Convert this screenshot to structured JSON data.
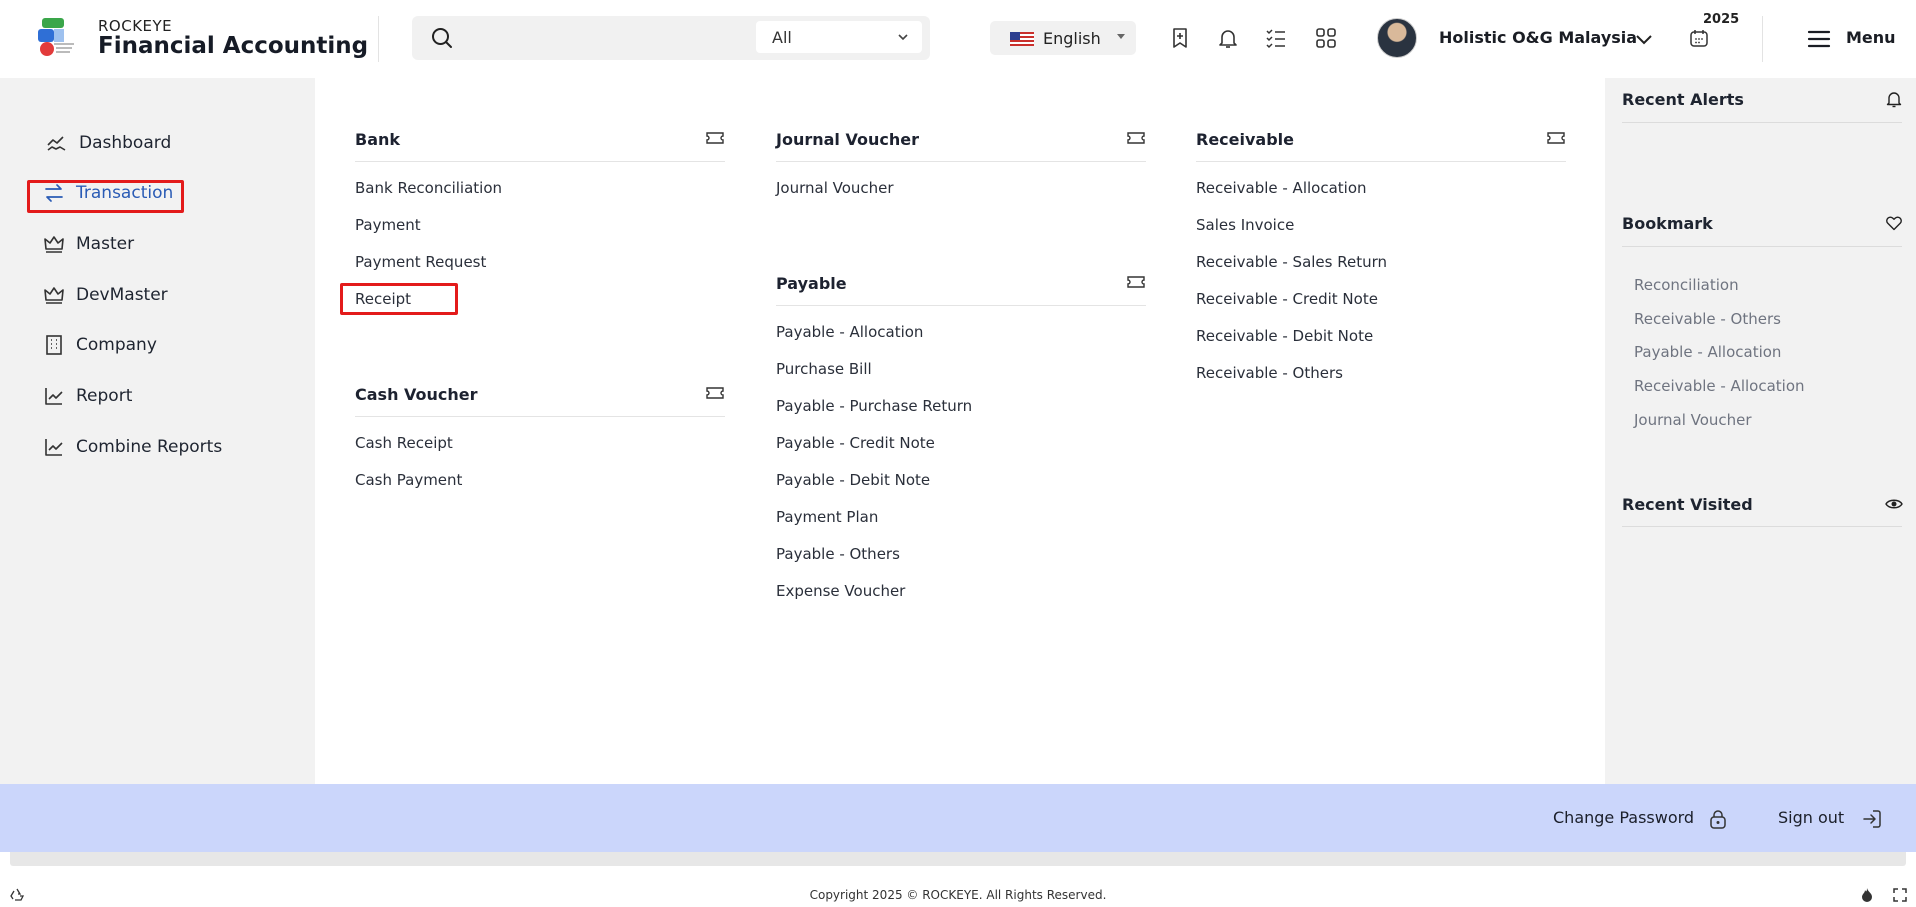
{
  "header": {
    "brand_small": "ROCKEYE",
    "brand_big": "Financial Accounting",
    "search_scope": "All",
    "language": "English",
    "company": "Holistic O&G Malaysia",
    "year": "2025",
    "menu_label": "Menu"
  },
  "sidebar": {
    "items": [
      {
        "label": "Dashboard",
        "icon": "chart-line-icon"
      },
      {
        "label": "Transaction",
        "icon": "swap-arrows-icon",
        "active": true
      },
      {
        "label": "Master",
        "icon": "crown-icon"
      },
      {
        "label": "DevMaster",
        "icon": "crown-icon"
      },
      {
        "label": "Company",
        "icon": "building-icon"
      },
      {
        "label": "Report",
        "icon": "report-chart-icon"
      },
      {
        "label": "Combine Reports",
        "icon": "report-chart-icon"
      }
    ]
  },
  "menu": {
    "bank": {
      "title": "Bank",
      "items": [
        "Bank Reconciliation",
        "Payment",
        "Payment Request",
        "Receipt"
      ]
    },
    "cash_voucher": {
      "title": "Cash Voucher",
      "items": [
        "Cash Receipt",
        "Cash Payment"
      ]
    },
    "journal_voucher": {
      "title": "Journal Voucher",
      "items": [
        "Journal Voucher"
      ]
    },
    "payable": {
      "title": "Payable",
      "items": [
        "Payable - Allocation",
        "Purchase Bill",
        "Payable - Purchase Return",
        "Payable - Credit Note",
        "Payable - Debit Note",
        "Payment Plan",
        "Payable - Others",
        "Expense Voucher"
      ]
    },
    "receivable": {
      "title": "Receivable",
      "items": [
        "Receivable - Allocation",
        "Sales Invoice",
        "Receivable - Sales Return",
        "Receivable - Credit Note",
        "Receivable - Debit Note",
        "Receivable - Others"
      ]
    }
  },
  "right_panel": {
    "recent_alerts": "Recent Alerts",
    "bookmark": "Bookmark",
    "bookmarks": [
      "Reconciliation",
      "Receivable - Others",
      "Payable - Allocation",
      "Receivable - Allocation",
      "Journal Voucher"
    ],
    "recent_visited": "Recent Visited"
  },
  "footer": {
    "change_password": "Change Password",
    "sign_out": "Sign out",
    "copyright": "Copyright 2025 © ROCKEYE. All Rights Reserved."
  },
  "colors": {
    "accent": "#2a5bb5",
    "highlight": "#e31b1b",
    "footer_bar": "#cbd6fb",
    "panel_bg": "#f2f2f2"
  }
}
